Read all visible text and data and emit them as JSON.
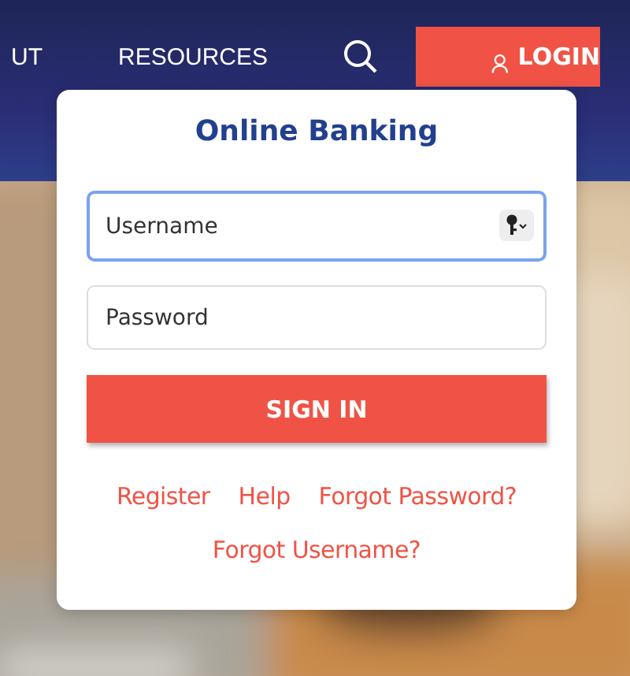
{
  "nav": {
    "items": [
      {
        "label": "UT"
      },
      {
        "label": "RESOURCES"
      }
    ],
    "login_button": {
      "label": "LOGIN"
    }
  },
  "login_card": {
    "title": "Online Banking",
    "fields": [
      {
        "placeholder": "Username",
        "focused": true,
        "kind": "text"
      },
      {
        "placeholder": "Password",
        "focused": false,
        "kind": "password"
      }
    ],
    "submit": "SIGN IN",
    "links": [
      {
        "label": "Register"
      },
      {
        "label": "Help"
      },
      {
        "label": "Forgot Password?"
      },
      {
        "label": "Forgot Username?"
      }
    ]
  }
}
